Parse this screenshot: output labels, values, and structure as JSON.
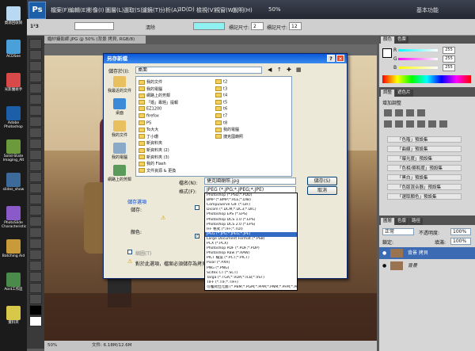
{
  "desktop": {
    "icons": [
      {
        "label": "資源回收筒"
      },
      {
        "label": "ACDSee"
      },
      {
        "label": "光影魔術手"
      },
      {
        "label": "Adobe Photoshop"
      },
      {
        "label": "Solid-State Imaging_Alt"
      },
      {
        "label": "slides_show"
      },
      {
        "label": "PhotoSlide Characteristic"
      },
      {
        "label": "Batching Aid"
      },
      {
        "label": "Aoid工作區"
      },
      {
        "label": "資料夾"
      }
    ]
  },
  "app": {
    "logo": "Ps",
    "menus": [
      "檔案(F)",
      "編輯(E)",
      "影像(I)",
      "圖層(L)",
      "選取(S)",
      "濾鏡(T)",
      "分析(A)",
      "3D(D)",
      "檢視(V)",
      "視窗(W)",
      "說明(H)"
    ],
    "zoom": "50%",
    "workspace": "基本功能"
  },
  "options": {
    "tool_preset": "1²3",
    "width_label": "標記尺寸:",
    "width_value": "2",
    "height_label": "標記尺寸:",
    "height_value": "12",
    "clear_label": "清除"
  },
  "document": {
    "tab_title": "婚紗攝影師.JPG @ 50% (背景 拷貝, RGB/8)",
    "status_zoom": "50%",
    "status_doc": "文件: 6.18M/12.6M"
  },
  "panels": {
    "color_tab": "顏色",
    "swatches_tab": "色票",
    "color_values": [
      "255",
      "255",
      "255"
    ],
    "channels": [
      "R",
      "G",
      "B"
    ],
    "adjust_tab": "調整",
    "masks_tab": "遮色片",
    "adjust_title": "增加調整",
    "presets": [
      "「色階」預設集",
      "「曲線」預設集",
      "「曝光度」預設集",
      "「色相/飽和度」預設集",
      "「黑白」預設集",
      "「色版混合器」預設集",
      "「選取顏色」預設集"
    ],
    "layers_tab": "圖層",
    "channels_tab": "色版",
    "paths_tab": "路徑",
    "blend_mode": "正常",
    "opacity_label": "不透明度:",
    "opacity_value": "100%",
    "lock_label": "鎖定:",
    "fill_label": "填滿:",
    "fill_value": "100%",
    "layers": [
      {
        "name": "背景 拷貝",
        "selected": true
      },
      {
        "name": "背景",
        "selected": false
      }
    ]
  },
  "dialog": {
    "title": "另存新檔",
    "save_in_label": "儲存於(I):",
    "save_in_value": "桌面",
    "places": [
      "我最近的文件",
      "桌面",
      "我的文件",
      "我的電腦",
      "網路上的芳鄰"
    ],
    "files_col1": [
      "我的文件",
      "我的電腦",
      "網路上的芳鄰",
      "「婚」專題」提報",
      "EZ1200",
      "firefox",
      "PS",
      "To大大",
      "丁小珊",
      "新資料夾",
      "新資料夾 (2)",
      "新資料夾 (3)",
      "我的 Flash",
      "文件資源 & 更換"
    ],
    "files_col2": [
      "t2",
      "t3",
      "t4",
      "t5",
      "t6",
      "t7",
      "t8",
      "我的電腦",
      "捷克國廟照"
    ],
    "filename_label": "檔名(N):",
    "filename_value": "捷克國廟照.jpg",
    "format_label": "格式(F):",
    "format_value": "JPEG (*.JPG;*.JPEG;*.JPE)",
    "save_button": "儲存(S)",
    "cancel_button": "取消",
    "save_options_label": "儲存選項",
    "save_label": "儲存:",
    "color_label": "顏色:",
    "thumbnail_label": "縮圖(T)",
    "footer_text": "對於此選項，檔案必須儲存為拷貝。",
    "format_options": [
      "Photoshop (*.PSD;*.PDD)",
      "BMP (*.BMP;*.RLE;*.DIB)",
      "CompuServe GIF (*.GIF)",
      "Dicom (*.DCM;*.DC3;*.DIC)",
      "Photoshop EPS (*.EPS)",
      "Photoshop DCS 1.0 (*.EPS)",
      "Photoshop DCS 2.0 (*.EPS)",
      "IFF 格式 (*.IFF;*.TDI)",
      "JPEG (*.JPG;*.JPEG;*.JPE)",
      "Large Document Format (*.PSB)",
      "PCX (*.PCX)",
      "Photoshop PDF (*.PDF;*.PDP)",
      "Photoshop Raw (*.RAW)",
      "PICT 檔案 (*.PCT;*.PICT)",
      "Pixar (*.PXR)",
      "PNG (*.PNG)",
      "Scitex CT (*.SCT)",
      "Targa (*.TGA;*.VDA;*.ICB;*.VST)",
      "TIFF (*.TIF;*.TIFF)",
      "可攜式位元圖 (*.PBM;*.PGM;*.PPM;*.PNM;*.PFM;*.PAM)"
    ],
    "selected_format_index": 8
  }
}
